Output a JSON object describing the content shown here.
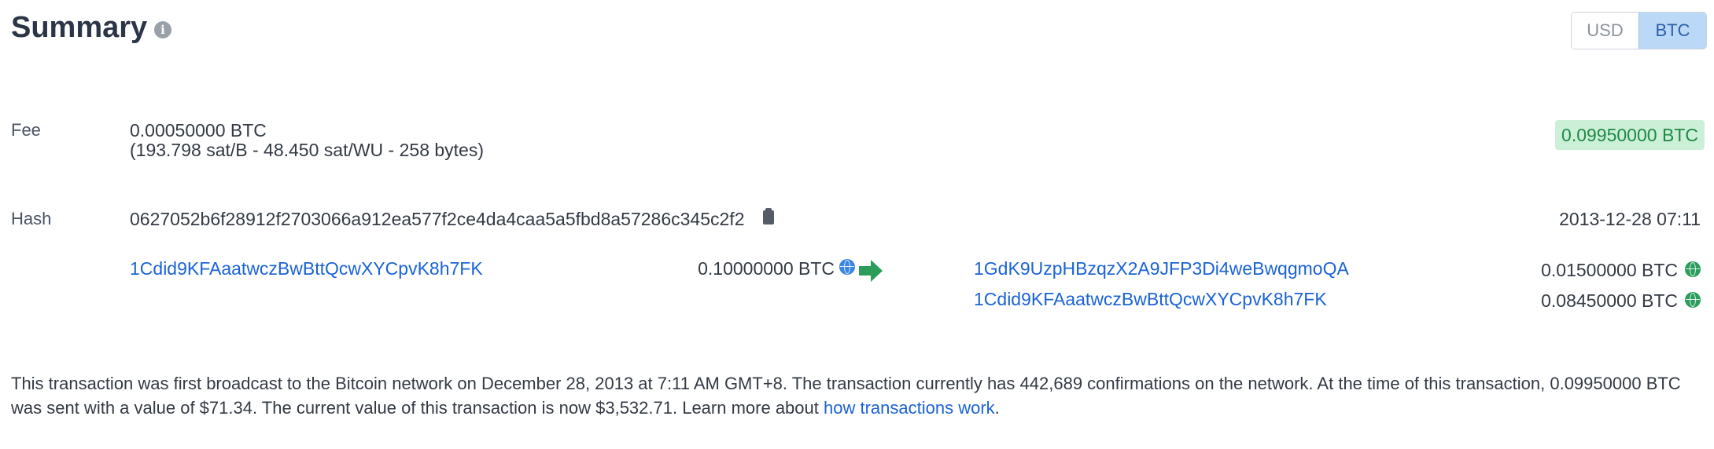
{
  "header": {
    "title": "Summary",
    "info_icon": "info-icon",
    "currency_toggle": {
      "options": [
        "USD",
        "BTC"
      ],
      "selected": "BTC"
    }
  },
  "fee": {
    "label": "Fee",
    "amount": "0.00050000 BTC",
    "detail": "(193.798 sat/B - 48.450 sat/WU - 258 bytes)",
    "total_badge": "0.09950000 BTC"
  },
  "hash": {
    "label": "Hash",
    "value": "0627052b6f28912f2703066a912ea577f2ce4da4caa5a5fbd8a57286c345c2f2",
    "timestamp": "2013-12-28 07:11"
  },
  "inputs": [
    {
      "address": "1Cdid9KFAaatwczBwBttQcwXYCpvK8h7FK",
      "amount": "0.10000000 BTC"
    }
  ],
  "outputs": [
    {
      "address": "1GdK9UzpHBzqzX2A9JFP3Di4weBwqgmoQA",
      "amount": "0.01500000 BTC"
    },
    {
      "address": "1Cdid9KFAaatwczBwBttQcwXYCpvK8h7FK",
      "amount": "0.08450000 BTC"
    }
  ],
  "description": {
    "text": "This transaction was first broadcast to the Bitcoin network on December 28, 2013 at 7:11 AM GMT+8.  The transaction currently has 442,689 confirmations on the network.  At the time of this transaction, 0.09950000 BTC was sent with a value of $71.34. The current value of this transaction is now $3,532.71.  Learn more about ",
    "link_text": "how transactions work",
    "end": "."
  },
  "colors": {
    "link": "#1a63d6",
    "badge_bg": "#ccefd8",
    "badge_text": "#1e8a45",
    "arrow": "#2a9d5b"
  }
}
